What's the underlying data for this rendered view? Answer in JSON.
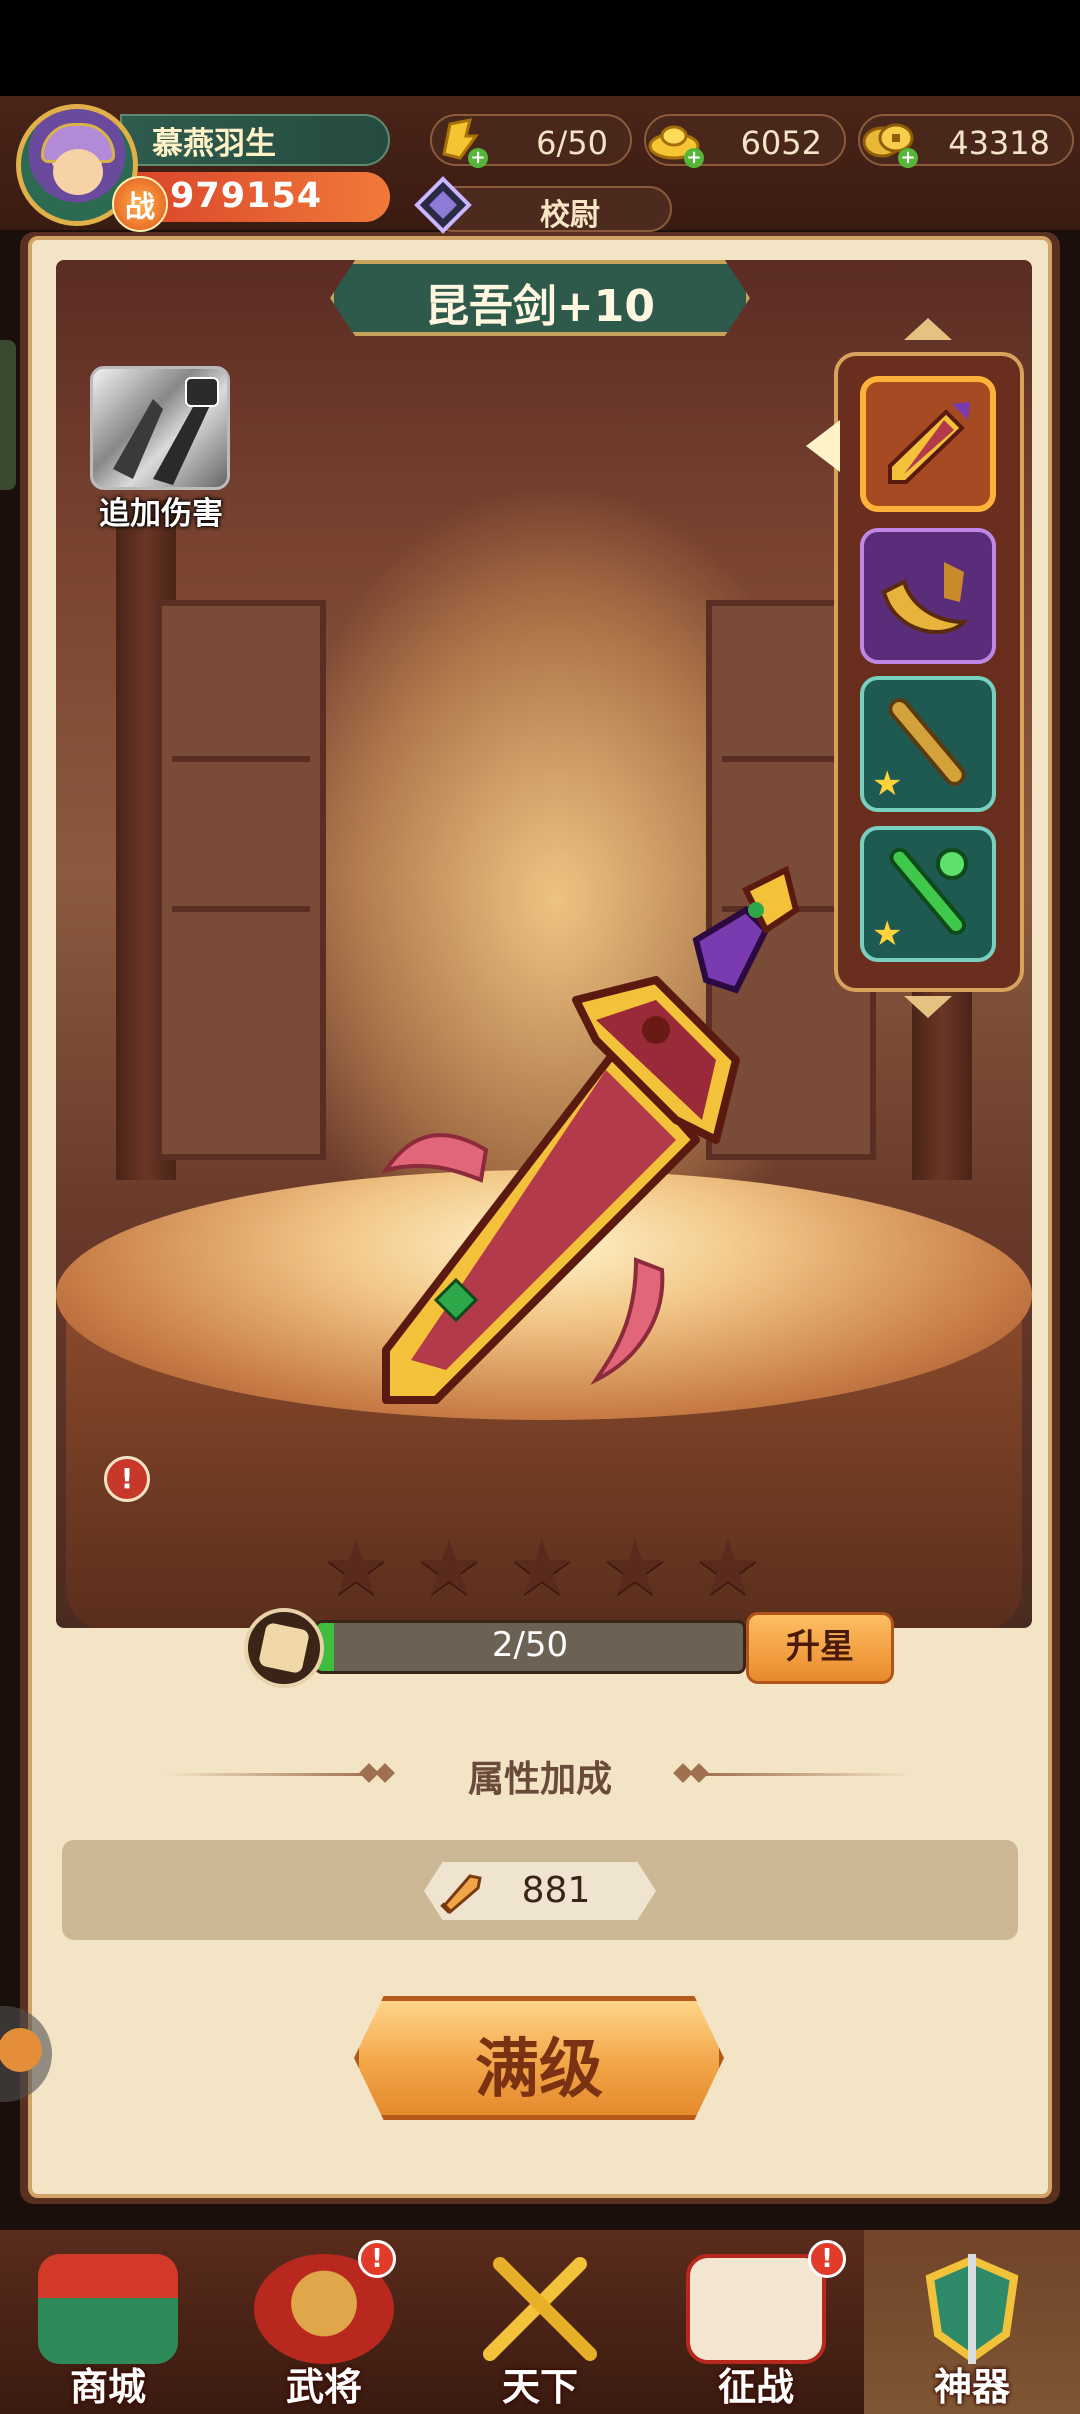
{
  "player": {
    "name": "慕燕羽生",
    "power_badge": "战",
    "power": "979154",
    "rank": "校尉"
  },
  "resources": [
    {
      "name": "stamina",
      "value": "6/50"
    },
    {
      "name": "gold-ingot",
      "value": "6052"
    },
    {
      "name": "coins",
      "value": "43318"
    }
  ],
  "artifact": {
    "title": "昆吾剑+10",
    "skill_label": "追加伤害",
    "stars_total": 5,
    "shard_progress": "2/50",
    "shard_fraction": 0.04,
    "upgrade_star_label": "升星",
    "attribute_title": "属性加成",
    "attribute_value": "881",
    "max_level_label": "满级",
    "info_glyph": "!"
  },
  "artifact_slots": [
    {
      "name": "kunwu-sword",
      "selected": true
    },
    {
      "name": "golden-blade",
      "selected": false
    },
    {
      "name": "bamboo-flute",
      "selected": false
    },
    {
      "name": "jade-scepter",
      "selected": false
    }
  ],
  "nav": [
    {
      "label": "商城",
      "badge": ""
    },
    {
      "label": "武将",
      "badge": "!"
    },
    {
      "label": "天下",
      "badge": ""
    },
    {
      "label": "征战",
      "badge": "!"
    },
    {
      "label": "神器",
      "badge": ""
    }
  ],
  "colors": {
    "accent_orange": "#f2a648",
    "panel_brown": "#5a3020",
    "teal_plate": "#2e5a4c",
    "progress_green": "#3fbd3c"
  }
}
